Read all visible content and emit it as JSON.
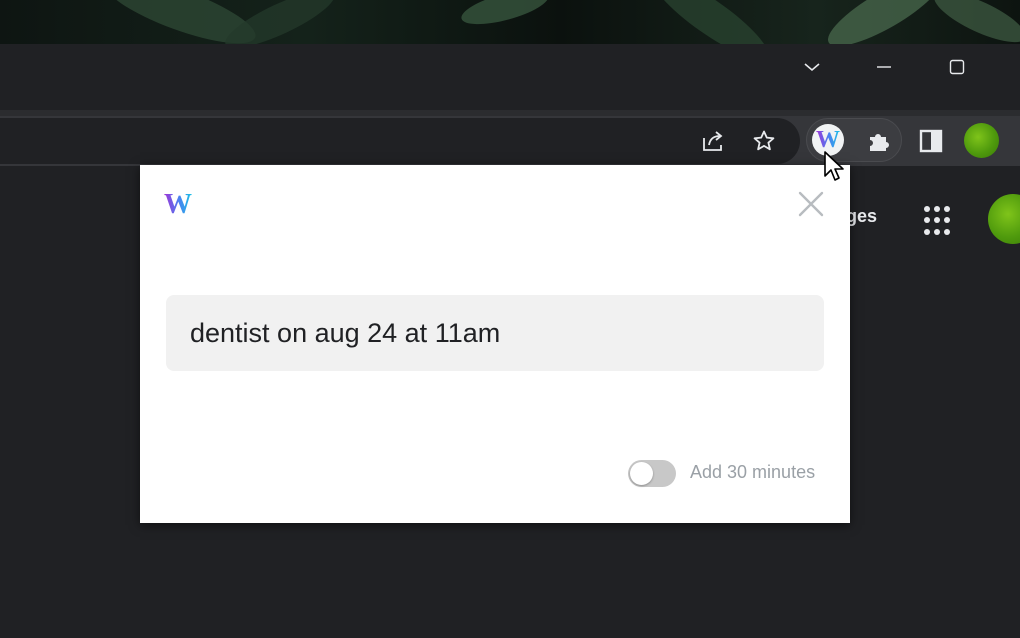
{
  "browser": {
    "window_controls": {
      "tab_search": "chevron-down-icon",
      "minimize": "minimize-icon",
      "maximize": "maximize-icon"
    },
    "toolbar": {
      "share": "share-icon",
      "bookmark": "star-icon",
      "extension_logo": "W",
      "extensions": "puzzle-icon",
      "side_panel": "side-panel-icon",
      "profile": "avatar"
    }
  },
  "page": {
    "link_text": "ges",
    "apps_icon": "apps-grid-icon"
  },
  "popup": {
    "logo": "W",
    "close_icon": "close-icon",
    "input": {
      "value": "dentist on aug 24 at 11am",
      "placeholder": ""
    },
    "toggle": {
      "label": "Add 30 minutes",
      "on": false
    }
  },
  "colors": {
    "accent_purple": "#a033d6",
    "accent_blue": "#19c3e6",
    "profile_green": "#5aa812"
  }
}
